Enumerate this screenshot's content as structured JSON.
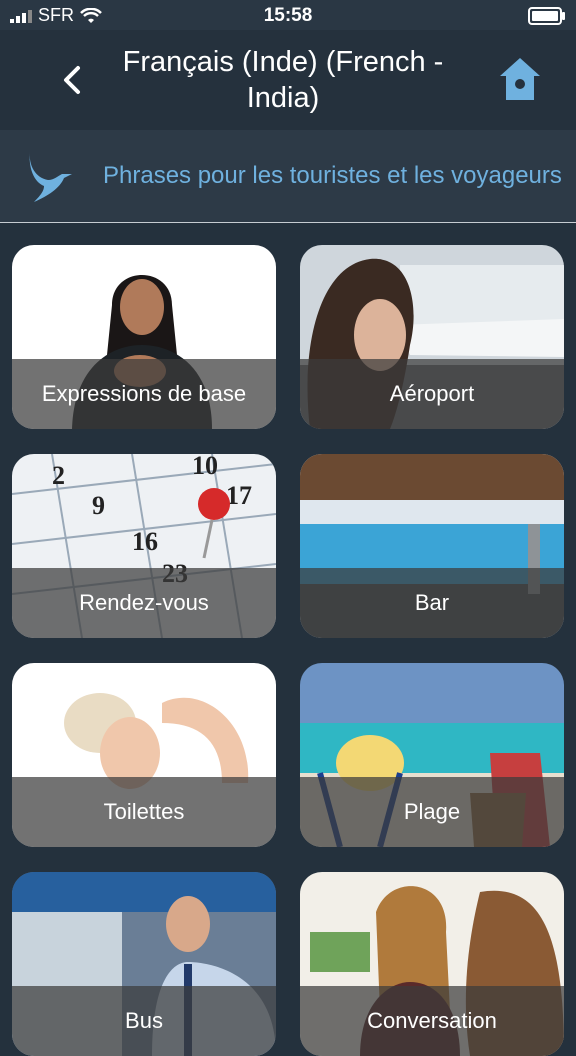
{
  "status_bar": {
    "carrier": "SFR",
    "time": "15:58",
    "icons": [
      "signal-icon",
      "wifi-icon",
      "battery-icon"
    ]
  },
  "nav": {
    "title_line1": "Français (Inde) (French -",
    "title_line2": "India)",
    "back_icon": "chevron-left-icon",
    "home_icon": "birdhouse-icon"
  },
  "header": {
    "subtitle": "Phrases pour les touristes et les voyageurs",
    "logo_icon": "bird-logo-icon"
  },
  "categories": [
    {
      "label": "Expressions de base"
    },
    {
      "label": "Aéroport"
    },
    {
      "label": "Rendez-vous"
    },
    {
      "label": "Bar"
    },
    {
      "label": "Toilettes"
    },
    {
      "label": "Plage"
    },
    {
      "label": "Bus"
    },
    {
      "label": "Conversation"
    }
  ],
  "colors": {
    "background": "#24313d",
    "accent": "#6fb1df",
    "label_band": "#3c3c3c"
  }
}
